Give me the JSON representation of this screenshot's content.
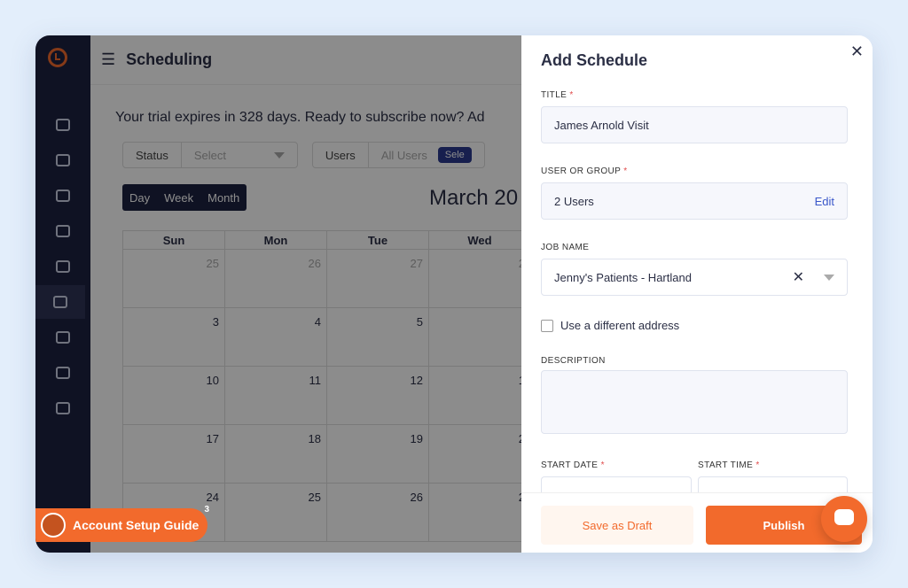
{
  "main": {
    "page_title": "Scheduling",
    "trial_text": "Your trial expires in 328 days. Ready to subscribe now? Ad",
    "filters": {
      "status_label": "Status",
      "status_value": "Select",
      "users_label": "Users",
      "users_value": "All Users",
      "select_btn": "Sele"
    },
    "views": [
      "Day",
      "Week",
      "Month"
    ],
    "month_title": "March 20",
    "calendar": {
      "headers": [
        "Sun",
        "Mon",
        "Tue",
        "Wed"
      ],
      "rows": [
        [
          "25",
          "26",
          "27",
          "2"
        ],
        [
          "3",
          "4",
          "5",
          ""
        ],
        [
          "10",
          "11",
          "12",
          "1"
        ],
        [
          "17",
          "18",
          "19",
          "2"
        ],
        [
          "24",
          "25",
          "26",
          "2"
        ]
      ]
    },
    "setup_guide": {
      "label": "Account Setup Guide",
      "badge": "3"
    }
  },
  "panel": {
    "title": "Add Schedule",
    "title_label": "TITLE",
    "title_value": "James Arnold Visit",
    "user_label": "USER OR GROUP",
    "user_value": "2 Users",
    "edit": "Edit",
    "job_label": "JOB NAME",
    "job_value": "Jenny's Patients - Hartland",
    "checkbox_label": "Use a different address",
    "desc_label": "DESCRIPTION",
    "start_date_label": "START DATE",
    "start_time_label": "START TIME",
    "required_mark": "*",
    "save_draft": "Save as Draft",
    "publish": "Publish"
  },
  "colors": {
    "accent": "#f26a2c",
    "sidebar": "#1d2240"
  },
  "icons": [
    "logo-icon",
    "menu-toggle-icon",
    "close-icon",
    "clear-icon",
    "chevron-down-icon",
    "chat-icon"
  ]
}
